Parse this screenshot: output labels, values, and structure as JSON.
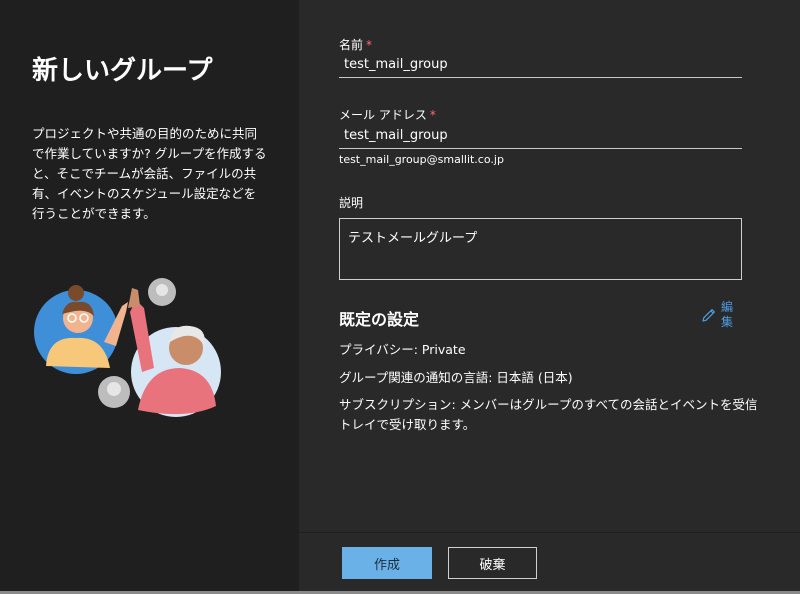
{
  "left": {
    "title": "新しいグループ",
    "description": "プロジェクトや共通の目的のために共同で作業していますか? グループを作成すると、そこでチームが会話、ファイルの共有、イベントのスケジュール設定などを行うことができます。"
  },
  "form": {
    "name": {
      "label": "名前",
      "required_mark": "*",
      "value": "test_mail_group"
    },
    "email": {
      "label": "メール アドレス",
      "required_mark": "*",
      "value": "test_mail_group",
      "full_address": "test_mail_group@smallit.co.jp"
    },
    "description": {
      "label": "説明",
      "value": "テストメールグループ"
    }
  },
  "defaults": {
    "title": "既定の設定",
    "edit_label": "編集",
    "privacy": "プライバシー: Private",
    "language": "グループ関連の通知の言語: 日本語 (日本)",
    "subscription": "サブスクリプション: メンバーはグループのすべての会話とイベントを受信トレイで受け取ります。"
  },
  "footer": {
    "create_label": "作成",
    "discard_label": "破棄"
  },
  "colors": {
    "left_bg": "#1f1f1f",
    "right_bg": "#292929",
    "primary_button": "#6ab1e7",
    "link_accent": "#4e9ce4",
    "required_mark": "#ff6b6b"
  }
}
